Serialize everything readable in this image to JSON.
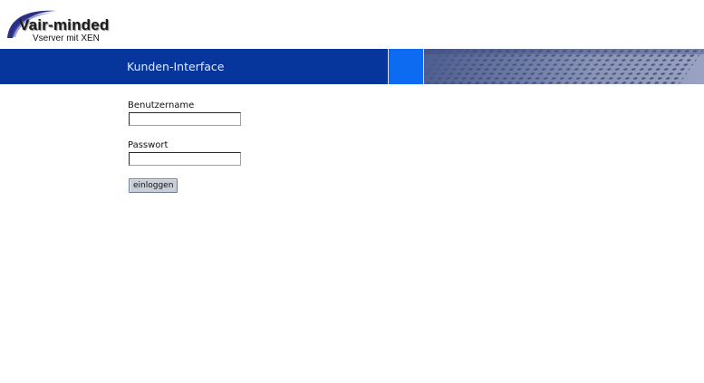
{
  "logo": {
    "title": "Vair-minded",
    "subtitle": "Vserver mit XEN",
    "swoosh_color": "#2b2f86"
  },
  "banner": {
    "title": "Kunden-Interface",
    "background_color": "#06359c",
    "accent_block_color": "#0d6bf2"
  },
  "login_form": {
    "username_label": "Benutzername",
    "username_value": "",
    "password_label": "Passwort",
    "password_value": "",
    "submit_label": "einloggen"
  }
}
